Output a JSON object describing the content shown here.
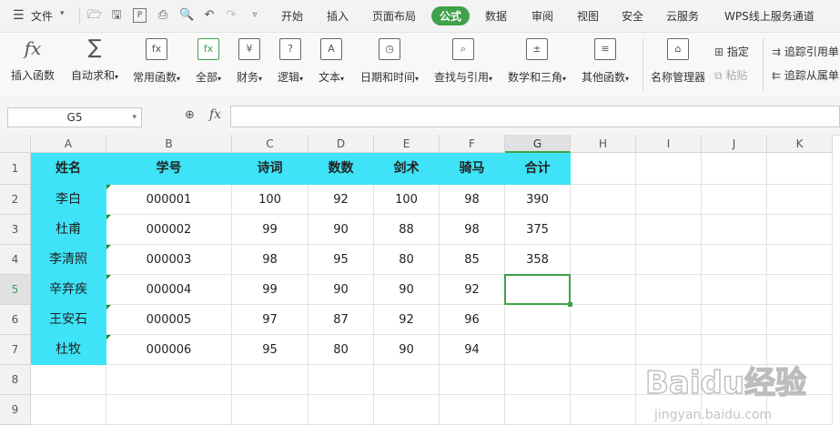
{
  "menubar": {
    "file_label": "文件",
    "tabs": [
      "开始",
      "插入",
      "页面布局",
      "公式",
      "数据",
      "审阅",
      "视图",
      "安全",
      "云服务",
      "WPS线上服务通道"
    ],
    "active_tab": "公式"
  },
  "ribbon": {
    "buttons": [
      {
        "label": "插入函数",
        "icon": "fx-icon"
      },
      {
        "label": "自动求和",
        "icon": "sigma-icon",
        "dropdown": true
      },
      {
        "label": "常用函数",
        "icon": "common-func-icon",
        "dropdown": true
      },
      {
        "label": "全部",
        "icon": "all-func-icon",
        "dropdown": true
      },
      {
        "label": "财务",
        "icon": "finance-icon",
        "dropdown": true
      },
      {
        "label": "逻辑",
        "icon": "logic-icon",
        "dropdown": true
      },
      {
        "label": "文本",
        "icon": "text-icon",
        "dropdown": true
      },
      {
        "label": "日期和时间",
        "icon": "datetime-icon",
        "dropdown": true
      },
      {
        "label": "查找与引用",
        "icon": "lookup-icon",
        "dropdown": true
      },
      {
        "label": "数学和三角",
        "icon": "math-icon",
        "dropdown": true
      },
      {
        "label": "其他函数",
        "icon": "other-func-icon",
        "dropdown": true
      },
      {
        "label": "名称管理器",
        "icon": "name-manager-icon"
      }
    ],
    "specify_label": "指定",
    "paste_label": "粘贴",
    "trace_precedents_label": "追踪引用单",
    "trace_dependents_label": "追踪从属单"
  },
  "formula_bar": {
    "name_box": "G5",
    "fx_label": "fx",
    "formula": ""
  },
  "sheet": {
    "columns": [
      "A",
      "B",
      "C",
      "D",
      "E",
      "F",
      "G",
      "H",
      "I",
      "J",
      "K"
    ],
    "rows": [
      "1",
      "2",
      "3",
      "4",
      "5",
      "6",
      "7",
      "8",
      "9"
    ],
    "header_row": [
      "姓名",
      "学号",
      "诗词",
      "数数",
      "剑术",
      "骑马",
      "合计"
    ],
    "data": [
      [
        "李白",
        "000001",
        "100",
        "92",
        "100",
        "98",
        "390"
      ],
      [
        "杜甫",
        "000002",
        "99",
        "90",
        "88",
        "98",
        "375"
      ],
      [
        "李清照",
        "000003",
        "98",
        "95",
        "80",
        "85",
        "358"
      ],
      [
        "辛弃疾",
        "000004",
        "99",
        "90",
        "90",
        "92",
        ""
      ],
      [
        "王安石",
        "000005",
        "97",
        "87",
        "92",
        "96",
        ""
      ],
      [
        "杜牧",
        "000006",
        "95",
        "80",
        "90",
        "94",
        ""
      ]
    ],
    "active_cell": "G5",
    "accent_color": "#3ee3f7",
    "selection_color": "#3fa14a"
  },
  "watermark": {
    "brand": "Baidu经验",
    "url": "jingyan.baidu.com"
  }
}
